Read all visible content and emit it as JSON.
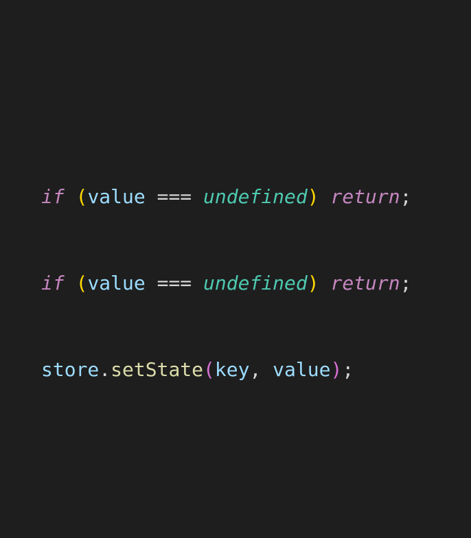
{
  "code": {
    "lines": [
      {
        "tokens": {
          "if": "if",
          "space1": " ",
          "lparen": "(",
          "value": "value",
          "space2": " ",
          "op": "===",
          "space3": " ",
          "undefined": "undefined",
          "rparen": ")",
          "space4": " ",
          "return": "return",
          "semi": ";"
        }
      },
      {
        "tokens": {
          "if": "if",
          "space1": " ",
          "lparen": "(",
          "value": "value",
          "space2": " ",
          "op": "===",
          "space3": " ",
          "undefined": "undefined",
          "rparen": ")",
          "space4": " ",
          "return": "return",
          "semi": ";"
        }
      },
      {
        "tokens": {
          "store": "store",
          "dot": ".",
          "setState": "setState",
          "lparen": "(",
          "key": "key",
          "comma": ",",
          "space1": " ",
          "value": "value",
          "rparen": ")",
          "semi": ";"
        }
      }
    ]
  }
}
